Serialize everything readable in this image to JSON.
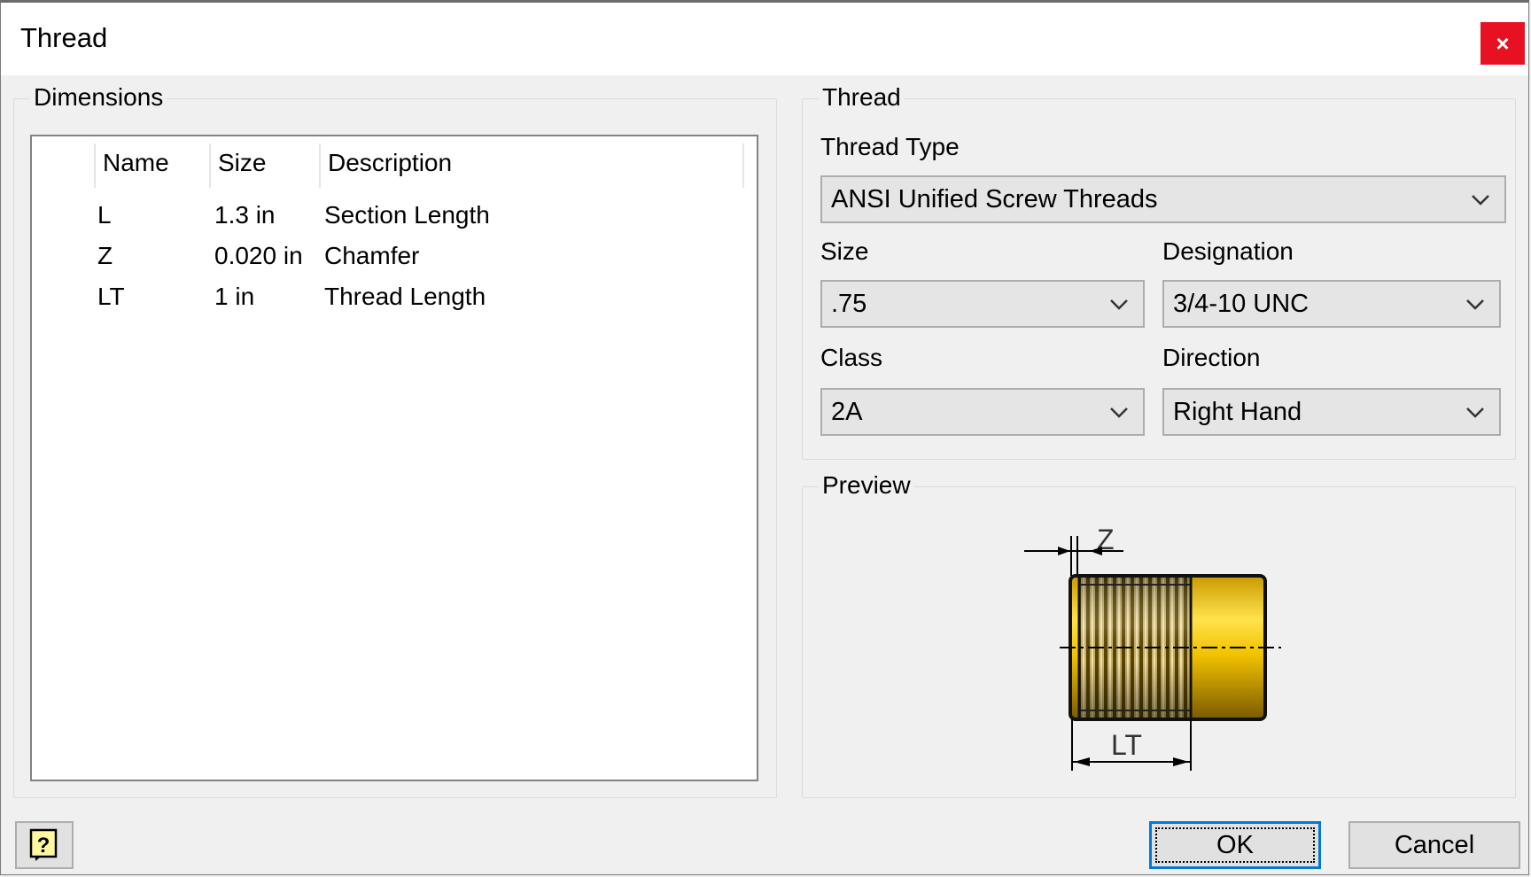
{
  "window": {
    "title": "Thread",
    "close_label": "×"
  },
  "dimensions": {
    "group_label": "Dimensions",
    "columns": {
      "name": "Name",
      "size": "Size",
      "description": "Description"
    },
    "rows": [
      {
        "name": "L",
        "size": "1.3 in",
        "description": "Section Length"
      },
      {
        "name": "Z",
        "size": "0.020 in",
        "description": "Chamfer"
      },
      {
        "name": "LT",
        "size": "1 in",
        "description": "Thread Length"
      }
    ]
  },
  "thread": {
    "group_label": "Thread",
    "thread_type_label": "Thread Type",
    "thread_type_value": "ANSI Unified Screw Threads",
    "size_label": "Size",
    "size_value": ".75",
    "designation_label": "Designation",
    "designation_value": "3/4-10 UNC",
    "class_label": "Class",
    "class_value": "2A",
    "direction_label": "Direction",
    "direction_value": "Right Hand"
  },
  "preview": {
    "group_label": "Preview",
    "z_label": "Z",
    "lt_label": "LT",
    "colors": {
      "body": "#f2c200",
      "thread_dark": "#6b5200",
      "thread_light": "#d9c27a"
    }
  },
  "buttons": {
    "help_icon": "help-icon",
    "ok_label": "OK",
    "cancel_label": "Cancel"
  }
}
